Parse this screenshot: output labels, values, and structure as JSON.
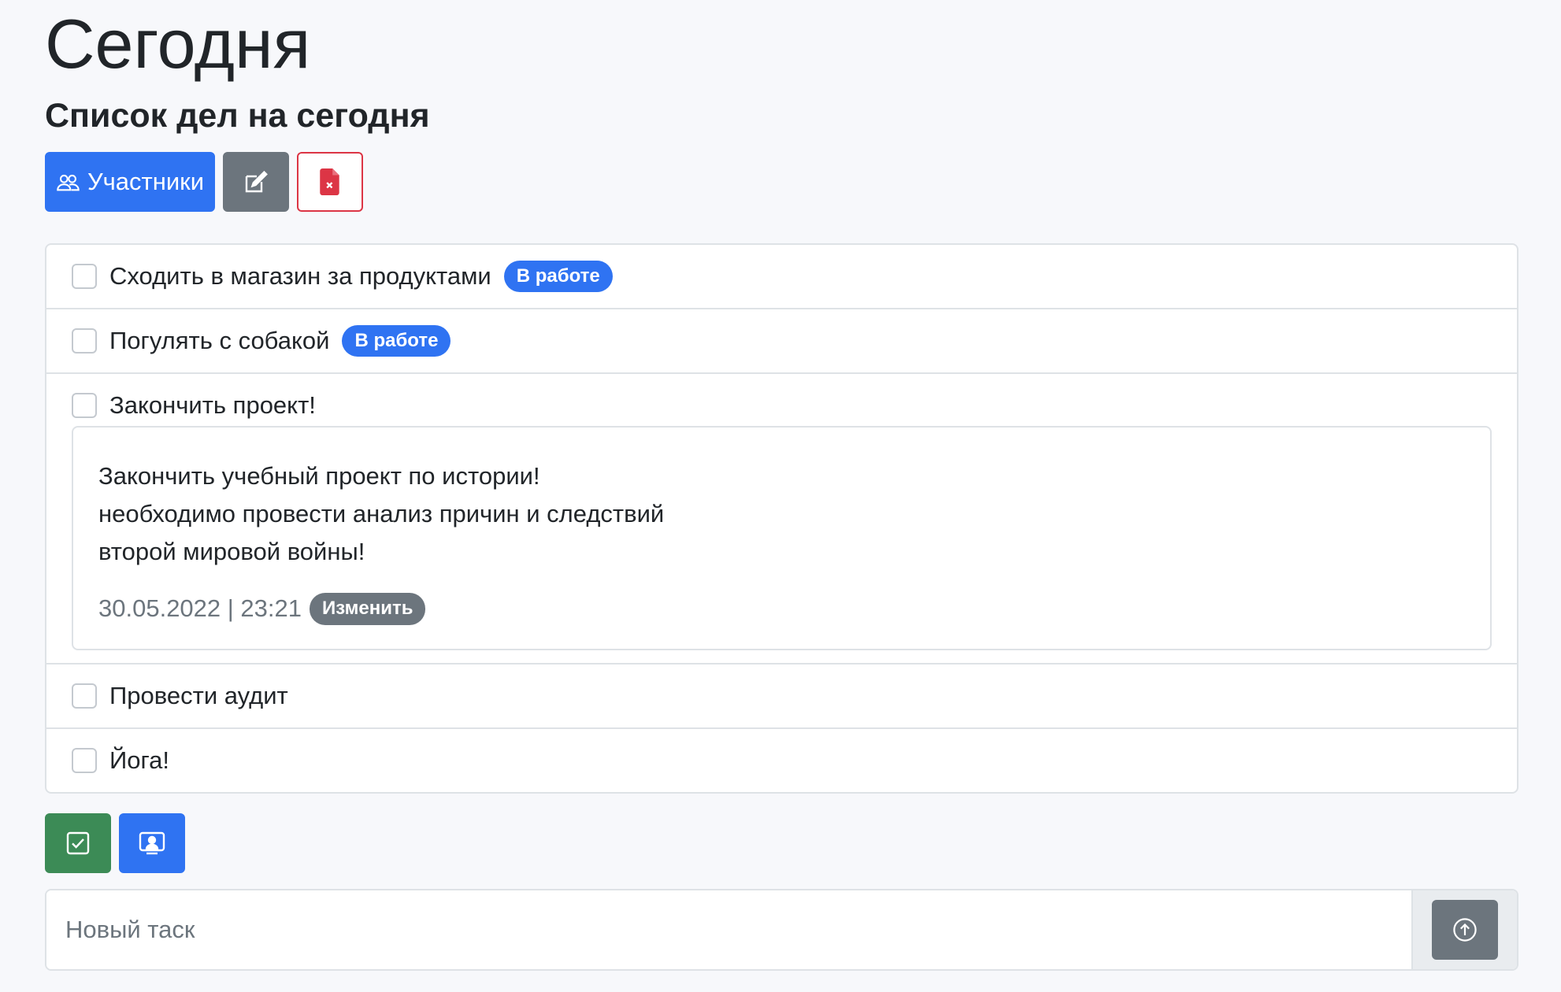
{
  "page": {
    "title": "Сегодня",
    "list_title": "Список дел на сегодня"
  },
  "toolbar": {
    "members_label": "Участники",
    "members_icon": "people-icon",
    "edit_icon": "pencil-square-icon",
    "delete_icon": "file-x-icon"
  },
  "tasks": [
    {
      "text": "Сходить в магазин за продуктами",
      "badge": "В работе",
      "checked": false
    },
    {
      "text": "Погулять с собакой",
      "badge": "В работе",
      "checked": false
    },
    {
      "text": "Закончить проект!",
      "checked": false,
      "details": {
        "lines": [
          "Закончить учебный проект по истории!",
          "необходимо провести анализ причин и следствий",
          "второй мировой войны!"
        ],
        "date": "30.05.2022 | 23:21",
        "edit_label": "Изменить"
      }
    },
    {
      "text": "Провести аудит",
      "checked": false
    },
    {
      "text": "Йога!",
      "checked": false
    }
  ],
  "bottom_actions": {
    "complete_icon": "check-square-icon",
    "assign_icon": "person-badge-icon"
  },
  "new_task": {
    "placeholder": "Новый таск",
    "value": "",
    "send_icon": "arrow-up-circle-icon"
  },
  "colors": {
    "primary": "#2f73f2",
    "secondary": "#6c757d",
    "success": "#3c8b56",
    "danger": "#dc3545"
  }
}
